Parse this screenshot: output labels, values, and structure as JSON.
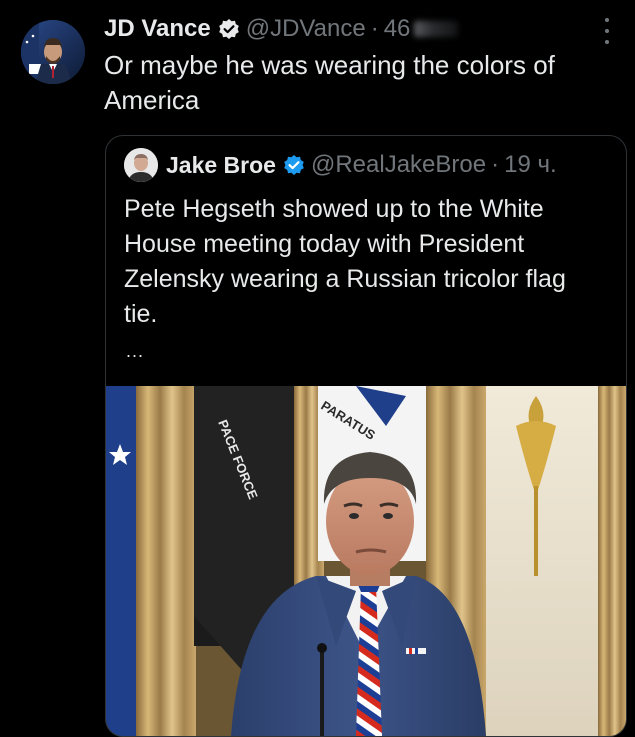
{
  "tweet": {
    "author_name": "JD Vance",
    "handle": "@JDVance",
    "separator": "·",
    "time": "46",
    "text": "Or maybe he was wearing the colors of America",
    "menu_icon": "more-vertical-icon",
    "verified_icon": "verified-badge-icon",
    "verified_color": "#1d9bf0"
  },
  "quote": {
    "author_name": "Jake Broe",
    "handle": "@RealJakeBroe",
    "separator": "·",
    "time": "19 ч.",
    "text": "Pete Hegseth showed up to the White House meeting today with President Zelensky wearing a Russian tricolor flag tie.",
    "ellipsis": "...",
    "media": {
      "flag_text_1": "PACE FORCE",
      "flag_text_2": "PARATUS",
      "tie_colors": [
        "#ffffff",
        "#1c3f95",
        "#d52b1e"
      ]
    }
  }
}
